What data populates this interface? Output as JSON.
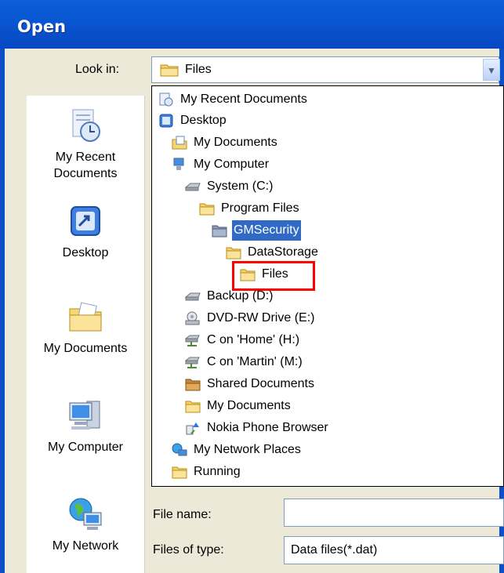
{
  "window": {
    "title": "Open"
  },
  "look_in": {
    "label": "Look in:",
    "value": "Files"
  },
  "places_bar": [
    {
      "label": "My Recent Documents",
      "icon": "recent-documents-icon"
    },
    {
      "label": "Desktop",
      "icon": "desktop-icon"
    },
    {
      "label": "My Documents",
      "icon": "my-documents-icon"
    },
    {
      "label": "My Computer",
      "icon": "my-computer-icon"
    },
    {
      "label": "My Network",
      "icon": "my-network-icon"
    }
  ],
  "tree": [
    {
      "label": "My Recent Documents",
      "icon": "recent-documents-icon"
    },
    {
      "label": "Desktop",
      "icon": "desktop-icon"
    },
    {
      "label": "My Documents",
      "icon": "my-documents-icon"
    },
    {
      "label": "My Computer",
      "icon": "my-computer-icon"
    },
    {
      "label": "System (C:)",
      "icon": "drive-icon"
    },
    {
      "label": "Program Files",
      "icon": "folder-icon"
    },
    {
      "label": "GMSecurity",
      "icon": "folder-icon",
      "selected": true
    },
    {
      "label": "DataStorage",
      "icon": "folder-icon"
    },
    {
      "label": "Files",
      "icon": "folder-icon",
      "highlighted": true
    },
    {
      "label": "Backup (D:)",
      "icon": "drive-icon"
    },
    {
      "label": "DVD-RW Drive (E:)",
      "icon": "dvd-drive-icon"
    },
    {
      "label": "C on 'Home' (H:)",
      "icon": "network-drive-icon"
    },
    {
      "label": "C on 'Martin' (M:)",
      "icon": "network-drive-icon"
    },
    {
      "label": "Shared Documents",
      "icon": "shared-folder-icon"
    },
    {
      "label": "My Documents",
      "icon": "folder-icon"
    },
    {
      "label": "Nokia Phone Browser",
      "icon": "phone-browser-icon"
    },
    {
      "label": "My Network Places",
      "icon": "network-places-icon"
    },
    {
      "label": "Running",
      "icon": "folder-icon"
    }
  ],
  "file_name": {
    "label": "File name:",
    "value": ""
  },
  "files_of_type": {
    "label": "Files of type:",
    "value": "Data files(*.dat)"
  },
  "colors": {
    "title_bar": "#0a57d2",
    "selection": "#316ac5",
    "highlight_box": "#ff0000",
    "dialog_bg": "#ece9d8"
  }
}
